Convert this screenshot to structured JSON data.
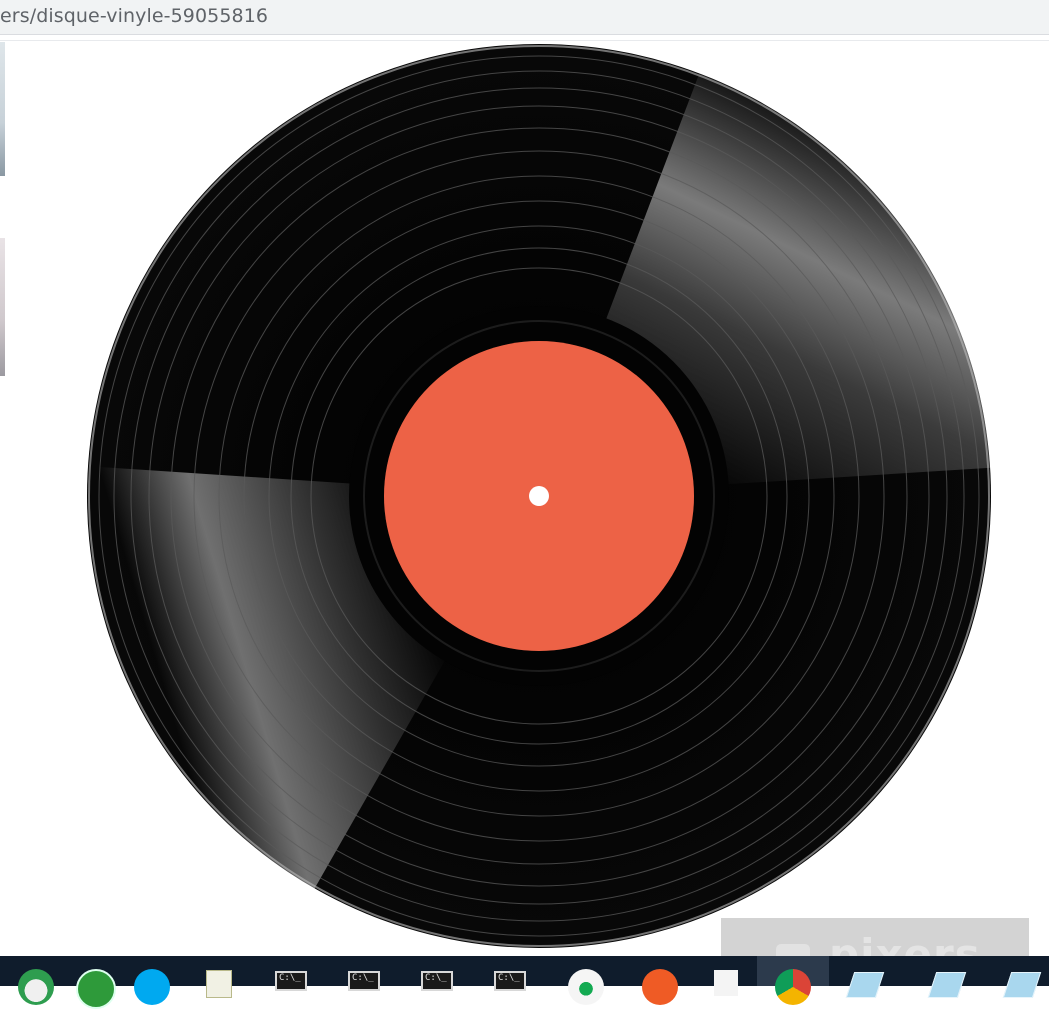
{
  "browser": {
    "url_fragment": "ers/disque-vinyle-59055816"
  },
  "watermark": {
    "text": "pixers"
  },
  "record": {
    "label_color": "#ef6448",
    "vinyl_color": "#050505"
  },
  "taskbar": {
    "items": [
      {
        "icon": "palm-app-icon"
      },
      {
        "icon": "green-app-icon"
      },
      {
        "icon": "skype-icon"
      },
      {
        "icon": "notepad-pencil-icon"
      },
      {
        "icon": "command-prompt-icon",
        "label": "C:\\_"
      },
      {
        "icon": "command-prompt-icon",
        "label": "C:\\_"
      },
      {
        "icon": "command-prompt-icon",
        "label": "C:\\_"
      },
      {
        "icon": "command-prompt-icon",
        "label": "C:\\_"
      },
      {
        "icon": "mongodb-leaf-icon"
      },
      {
        "icon": "postman-icon"
      },
      {
        "icon": "blank-document-icon"
      },
      {
        "icon": "chrome-icon",
        "active": true
      },
      {
        "icon": "note-pad-icon"
      },
      {
        "icon": "note-pad-icon"
      },
      {
        "icon": "note-pad-icon"
      }
    ]
  }
}
